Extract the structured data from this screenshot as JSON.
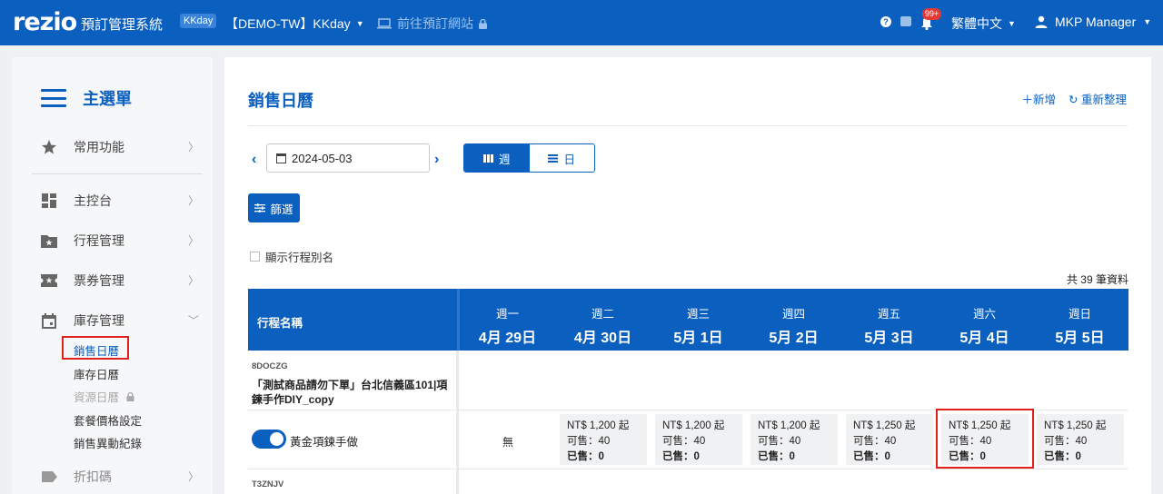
{
  "topbar": {
    "logo": "rezio",
    "system_title": "預訂管理系統",
    "tenant_tag": "KKday",
    "tenant_name": "【DEMO-TW】KKday",
    "goto_site": "前往預訂網站",
    "notif_badge": "99+",
    "language": "繁體中文",
    "user": "MKP Manager"
  },
  "sidebar": {
    "title": "主選單",
    "items": [
      {
        "label": "常用功能",
        "icon": "star-icon"
      },
      {
        "label": "主控台",
        "icon": "dashboard-icon"
      },
      {
        "label": "行程管理",
        "icon": "folder-star-icon"
      },
      {
        "label": "票券管理",
        "icon": "ticket-icon"
      },
      {
        "label": "庫存管理",
        "icon": "calendar-icon"
      },
      {
        "label": "折扣碼",
        "icon": "tag-icon"
      }
    ],
    "inventory_sub": [
      {
        "label": "銷售日曆"
      },
      {
        "label": "庫存日曆"
      },
      {
        "label": "資源日曆"
      },
      {
        "label": "套餐價格設定"
      },
      {
        "label": "銷售異動紀錄"
      }
    ]
  },
  "main": {
    "title": "銷售日曆",
    "add_label": "新增",
    "refresh_label": "重新整理",
    "date": "2024-05-03",
    "view_week": "週",
    "view_day": "日",
    "filter_label": "篩選",
    "show_alias_label": "顯示行程別名",
    "total_text": "共 39 筆資料",
    "table": {
      "name_header": "行程名稱",
      "days": [
        {
          "weekday": "週一",
          "date": "4月 29日"
        },
        {
          "weekday": "週二",
          "date": "4月 30日"
        },
        {
          "weekday": "週三",
          "date": "5月 1日"
        },
        {
          "weekday": "週四",
          "date": "5月 2日"
        },
        {
          "weekday": "週五",
          "date": "5月 3日"
        },
        {
          "weekday": "週六",
          "date": "5月 4日"
        },
        {
          "weekday": "週日",
          "date": "5月 5日"
        }
      ],
      "products": [
        {
          "code": "8DOCZG",
          "name": "「測試商品請勿下單」台北信義區101|項鍊手作DIY_copy",
          "package": {
            "name": "黃金項鍊手做",
            "enabled": true,
            "no_data": "無",
            "cells": [
              {
                "price": "NT$ 1,200 起",
                "avail": "可售：40",
                "sold": "已售：0"
              },
              {
                "price": "NT$ 1,200 起",
                "avail": "可售：40",
                "sold": "已售：0"
              },
              {
                "price": "NT$ 1,200 起",
                "avail": "可售：40",
                "sold": "已售：0"
              },
              {
                "price": "NT$ 1,250 起",
                "avail": "可售：40",
                "sold": "已售：0"
              },
              {
                "price": "NT$ 1,250 起",
                "avail": "可售：40",
                "sold": "已售：0"
              },
              {
                "price": "NT$ 1,250 起",
                "avail": "可售：40",
                "sold": "已售：0"
              }
            ]
          }
        },
        {
          "code": "T3ZNJV"
        }
      ]
    }
  },
  "colors": {
    "brand": "#0a5fbf",
    "highlight": "#e0201a"
  }
}
